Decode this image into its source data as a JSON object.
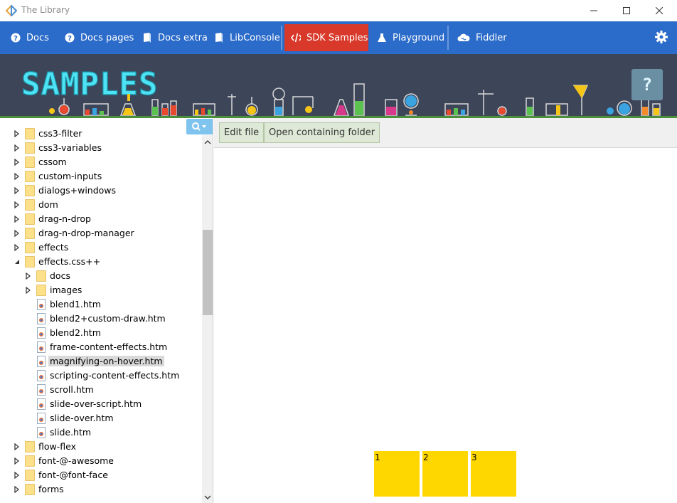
{
  "window": {
    "title": "The Library",
    "app_icon": "diamond-logo-icon",
    "controls": [
      "minimize-icon",
      "maximize-icon",
      "close-icon"
    ]
  },
  "nav": {
    "items": [
      {
        "label": "Docs",
        "icon": "question-circle-icon"
      },
      {
        "label": "Docs pages",
        "icon": "question-circle-icon"
      },
      {
        "label": "Docs extra",
        "icon": "book-icon"
      },
      {
        "label": "LibConsole",
        "icon": "book-icon"
      },
      {
        "label": "SDK Samples",
        "icon": "code-icon",
        "active": true
      },
      {
        "label": "Playground",
        "icon": "flask-icon"
      },
      {
        "label": "Fiddler",
        "icon": "cloud-icon"
      }
    ],
    "settings_icon": "gear-icon",
    "accent_color": "#2b6bc9",
    "active_color": "#d8392b"
  },
  "banner": {
    "title": "SAMPLES",
    "help_label": "?",
    "title_color": "#4de3f5"
  },
  "sidebar": {
    "search_icon": "search-dropdown-icon",
    "tree": [
      {
        "label": "css3-filter",
        "type": "folder",
        "level": 0,
        "state": "collapsed"
      },
      {
        "label": "css3-variables",
        "type": "folder",
        "level": 0,
        "state": "collapsed"
      },
      {
        "label": "cssom",
        "type": "folder",
        "level": 0,
        "state": "collapsed"
      },
      {
        "label": "custom-inputs",
        "type": "folder",
        "level": 0,
        "state": "collapsed"
      },
      {
        "label": "dialogs+windows",
        "type": "folder",
        "level": 0,
        "state": "collapsed"
      },
      {
        "label": "dom",
        "type": "folder",
        "level": 0,
        "state": "collapsed"
      },
      {
        "label": "drag-n-drop",
        "type": "folder",
        "level": 0,
        "state": "collapsed"
      },
      {
        "label": "drag-n-drop-manager",
        "type": "folder",
        "level": 0,
        "state": "collapsed"
      },
      {
        "label": "effects",
        "type": "folder",
        "level": 0,
        "state": "collapsed"
      },
      {
        "label": "effects.css++",
        "type": "folder",
        "level": 0,
        "state": "expanded"
      },
      {
        "label": "docs",
        "type": "folder",
        "level": 1,
        "state": "collapsed"
      },
      {
        "label": "images",
        "type": "folder",
        "level": 1,
        "state": "collapsed"
      },
      {
        "label": "blend1.htm",
        "type": "file",
        "level": 1
      },
      {
        "label": "blend2+custom-draw.htm",
        "type": "file",
        "level": 1
      },
      {
        "label": "blend2.htm",
        "type": "file",
        "level": 1
      },
      {
        "label": "frame-content-effects.htm",
        "type": "file",
        "level": 1
      },
      {
        "label": "magnifying-on-hover.htm",
        "type": "file",
        "level": 1,
        "selected": true
      },
      {
        "label": "scripting-content-effects.htm",
        "type": "file",
        "level": 1
      },
      {
        "label": "scroll.htm",
        "type": "file",
        "level": 1
      },
      {
        "label": "slide-over-script.htm",
        "type": "file",
        "level": 1
      },
      {
        "label": "slide-over.htm",
        "type": "file",
        "level": 1
      },
      {
        "label": "slide.htm",
        "type": "file",
        "level": 1
      },
      {
        "label": "flow-flex",
        "type": "folder",
        "level": 0,
        "state": "collapsed"
      },
      {
        "label": "font-@-awesome",
        "type": "folder",
        "level": 0,
        "state": "collapsed"
      },
      {
        "label": "font-@font-face",
        "type": "folder",
        "level": 0,
        "state": "collapsed"
      },
      {
        "label": "forms",
        "type": "folder",
        "level": 0,
        "state": "collapsed"
      }
    ]
  },
  "toolbar": {
    "edit_label": "Edit file",
    "open_folder_label": "Open containing folder"
  },
  "preview": {
    "boxes": [
      "1",
      "2",
      "3"
    ],
    "box_color": "#ffd700"
  }
}
